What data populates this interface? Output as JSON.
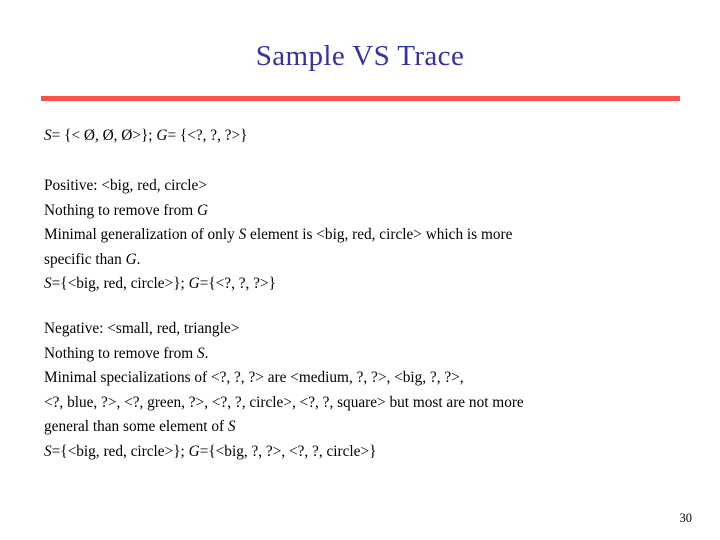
{
  "slide": {
    "title": "Sample VS Trace",
    "title_color": "#3333a6",
    "rule_color": "#f9514c",
    "page_number": "30",
    "initial_state": {
      "line": "S= {< Ø, Ø, Ø>}; G= {<?, ?, ?>}"
    },
    "positive_step": {
      "lines": [
        "Positive: <big, red, circle>",
        "Nothing to remove from G",
        "Minimal generalization of only S element is <big, red, circle> which is more",
        "specific than G.",
        "S={<big, red, circle>}; G={<?, ?, ?>}"
      ]
    },
    "negative_step": {
      "lines": [
        "Negative: <small, red, triangle>",
        "Nothing to remove from S.",
        "Minimal specializations of <?, ?, ?> are <medium, ?, ?>, <big, ?, ?>,",
        "<?, blue, ?>, <?, green, ?>, <?, ?, circle>, <?, ?, square> but most are not more",
        "general than some element of S",
        "S={<big, red, circle>}; G={<big, ?, ?>, <?, ?, circle>}"
      ]
    }
  }
}
